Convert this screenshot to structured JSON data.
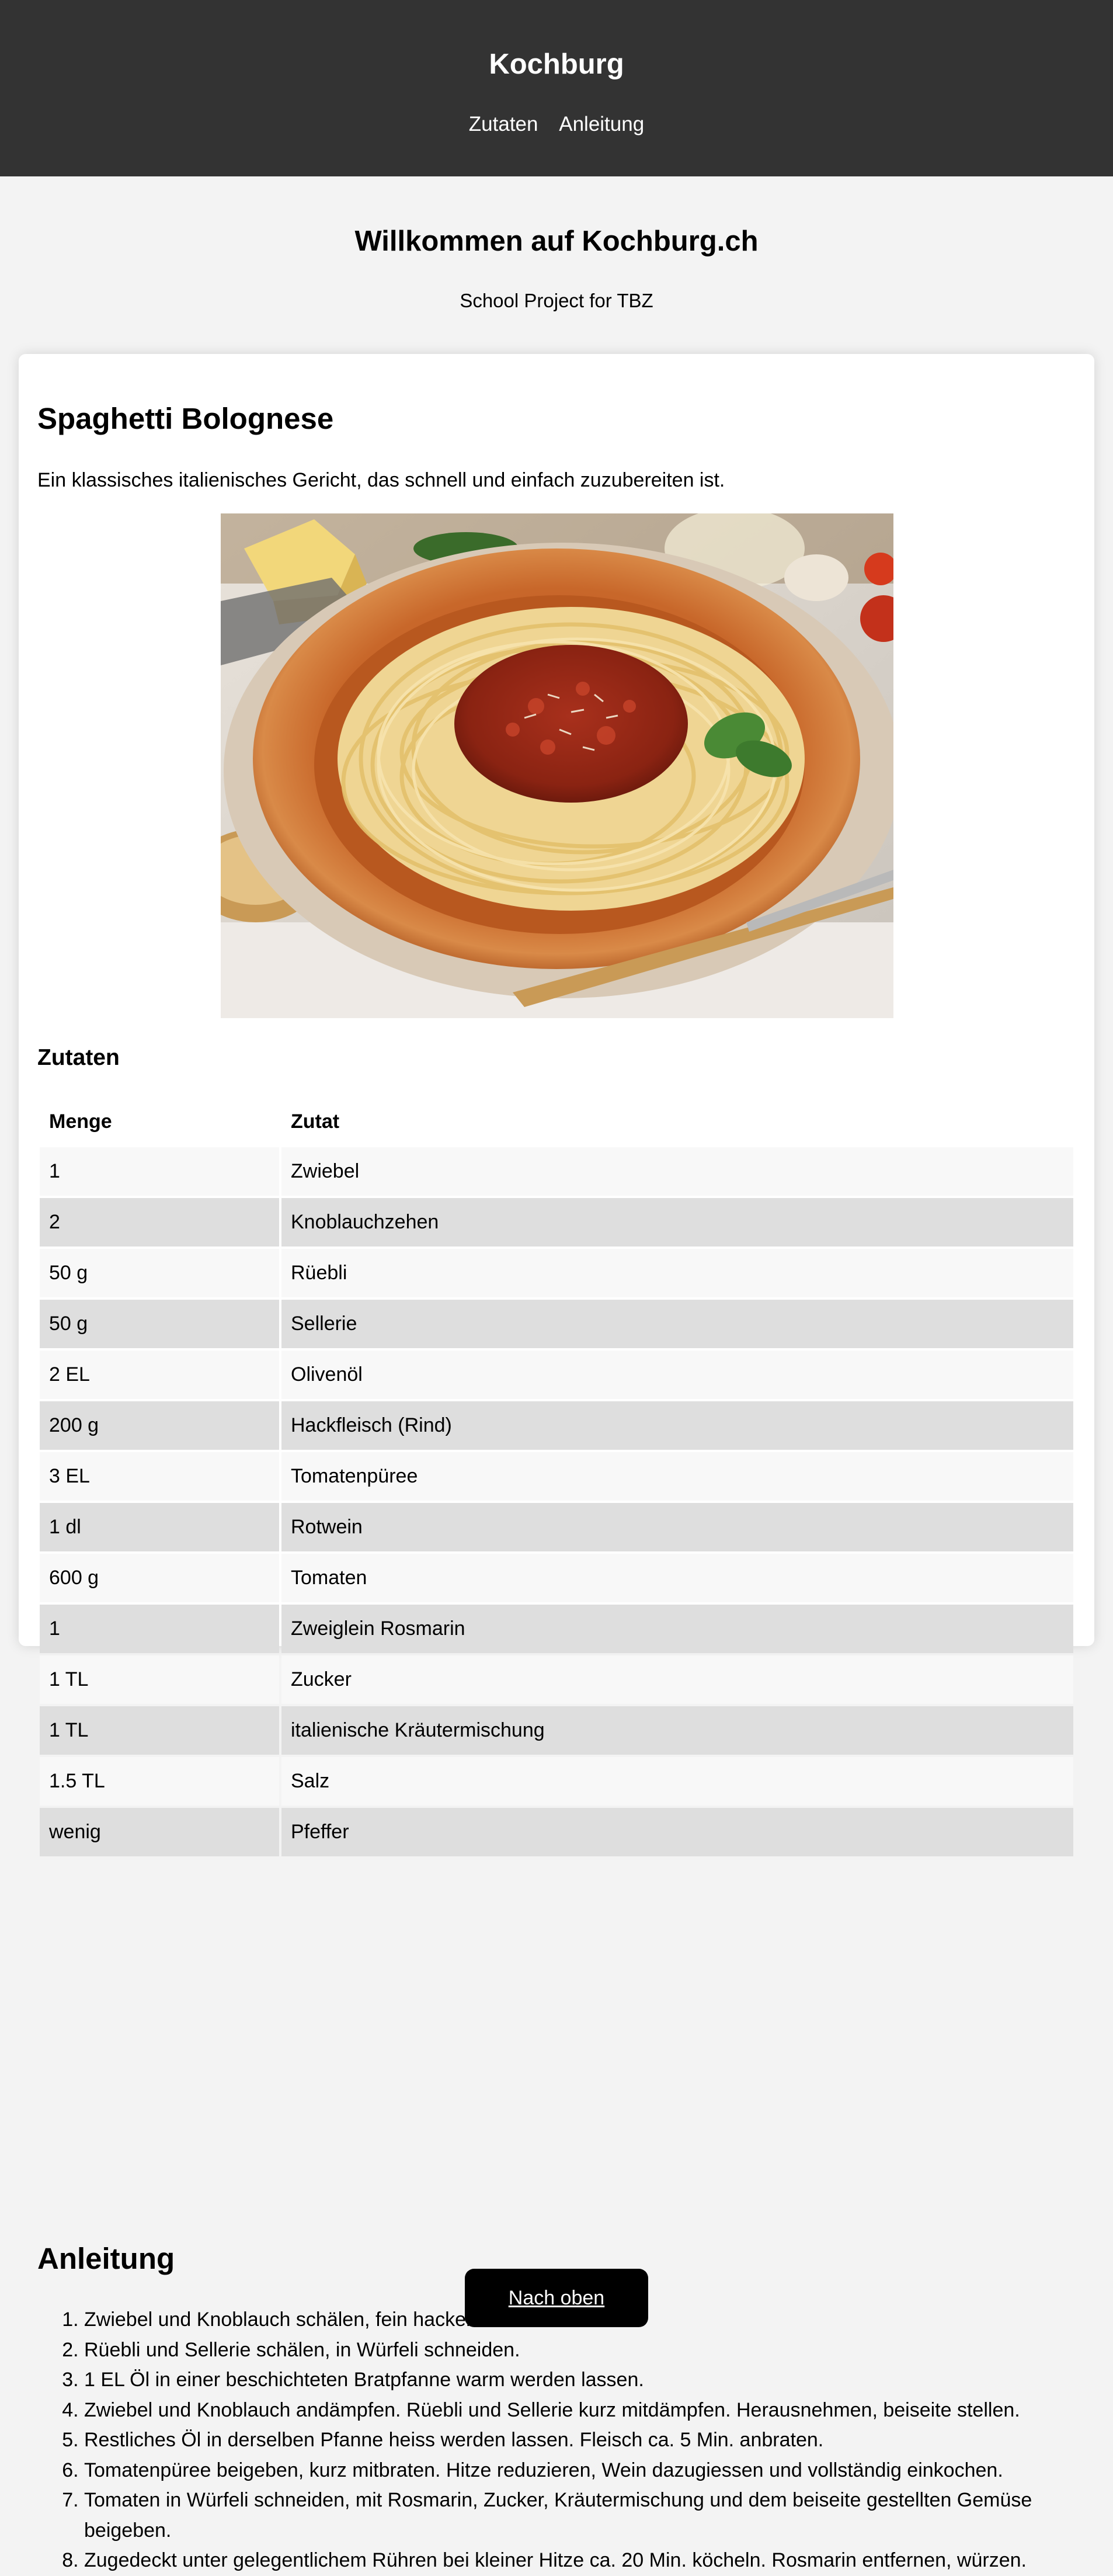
{
  "header": {
    "site_title": "Kochburg",
    "nav": [
      {
        "label": "Zutaten"
      },
      {
        "label": "Anleitung"
      }
    ]
  },
  "welcome": {
    "title": "Willkommen auf Kochburg.ch",
    "subtitle": "School Project for TBZ"
  },
  "recipe": {
    "title": "Spaghetti Bolognese",
    "description": "Ein klassisches italienisches Gericht, das schnell und einfach zuzubereiten ist.",
    "ingredients_heading": "Zutaten",
    "table_headers": {
      "quantity": "Menge",
      "ingredient": "Zutat"
    },
    "ingredients": [
      {
        "quantity": "1",
        "ingredient": "Zwiebel"
      },
      {
        "quantity": "2",
        "ingredient": "Knoblauchzehen"
      },
      {
        "quantity": "50 g",
        "ingredient": "Rüebli"
      },
      {
        "quantity": "50 g",
        "ingredient": "Sellerie"
      },
      {
        "quantity": "2 EL",
        "ingredient": "Olivenöl"
      },
      {
        "quantity": "200 g",
        "ingredient": "Hackfleisch (Rind)"
      },
      {
        "quantity": "3 EL",
        "ingredient": "Tomatenpüree"
      },
      {
        "quantity": "1 dl",
        "ingredient": "Rotwein"
      },
      {
        "quantity": "600 g",
        "ingredient": "Tomaten"
      },
      {
        "quantity": "1",
        "ingredient": "Zweiglein Rosmarin"
      },
      {
        "quantity": "1 TL",
        "ingredient": "Zucker"
      },
      {
        "quantity": "1 TL",
        "ingredient": "italienische Kräutermischung"
      },
      {
        "quantity": "1.5 TL",
        "ingredient": "Salz"
      },
      {
        "quantity": "wenig",
        "ingredient": "Pfeffer"
      }
    ],
    "instructions_heading": "Anleitung",
    "steps": [
      "Zwiebel und Knoblauch schälen, fein hacken.",
      "Rüebli und Sellerie schälen, in Würfeli schneiden.",
      "1 EL Öl in einer beschichteten Bratpfanne warm werden lassen.",
      "Zwiebel und Knoblauch andämpfen. Rüebli und Sellerie kurz mitdämpfen. Herausnehmen, beiseite stellen.",
      "Restliches Öl in derselben Pfanne heiss werden lassen. Fleisch ca. 5 Min. anbraten.",
      "Tomatenpüree beigeben, kurz mitbraten. Hitze reduzieren, Wein dazugiessen und vollständig einkochen.",
      "Tomaten in Würfeli schneiden, mit Rosmarin, Zucker, Kräutermischung und dem beiseite gestellten Gemüse beigeben.",
      "Zugedeckt unter gelegentlichem Rühren bei kleiner Hitze ca. 20 Min. köcheln. Rosmarin entfernen, würzen."
    ]
  },
  "footer": {
    "back_to_top_label": "Nach oben"
  },
  "colors": {
    "header_bg": "#333333",
    "page_bg": "#f3f3f3",
    "button_bg": "#000000",
    "row_light": "#f8f8f8",
    "row_dark": "#dedede"
  }
}
